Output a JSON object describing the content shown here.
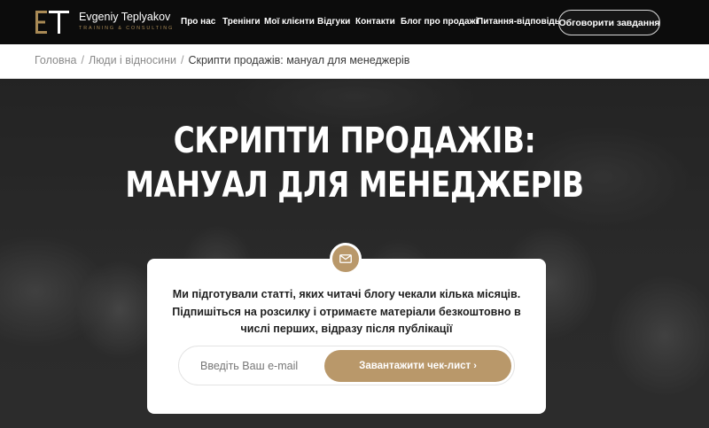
{
  "brand": {
    "name": "Evgeniy Teplyakov",
    "tagline": "TRAINING & CONSULTING",
    "accent_color": "#b9986a",
    "logo_icon": "et-logo-icon"
  },
  "nav": {
    "items": [
      {
        "label": "Про нас"
      },
      {
        "label": "Тренінги"
      },
      {
        "label": "Мої клієнти"
      },
      {
        "label": "Відгуки"
      },
      {
        "label": "Контакти"
      },
      {
        "label": "Блог про продажі"
      },
      {
        "label": "Питання-відповідь"
      }
    ],
    "cta_label": "Обговорити завдання"
  },
  "breadcrumb": {
    "items": [
      "Головна",
      "Люди і відносини"
    ],
    "separator": "/",
    "current": "Скрипти продажів: мануал для менеджерів"
  },
  "hero": {
    "title": "СКРИПТИ ПРОДАЖІВ: МАНУАЛ ДЛЯ МЕНЕДЖЕРІВ"
  },
  "subscribe": {
    "icon": "envelope-icon",
    "text": "Ми підготували статті, яких читачі блогу чекали кілька місяців. Підпишіться на розсилку і отримаєте матеріали безкоштовно в числі перших, відразу після публікації",
    "email_placeholder": "Введіть Ваш e-mail",
    "email_value": "",
    "button_label": "Завантажити чек-лист",
    "button_chevron": "›"
  }
}
